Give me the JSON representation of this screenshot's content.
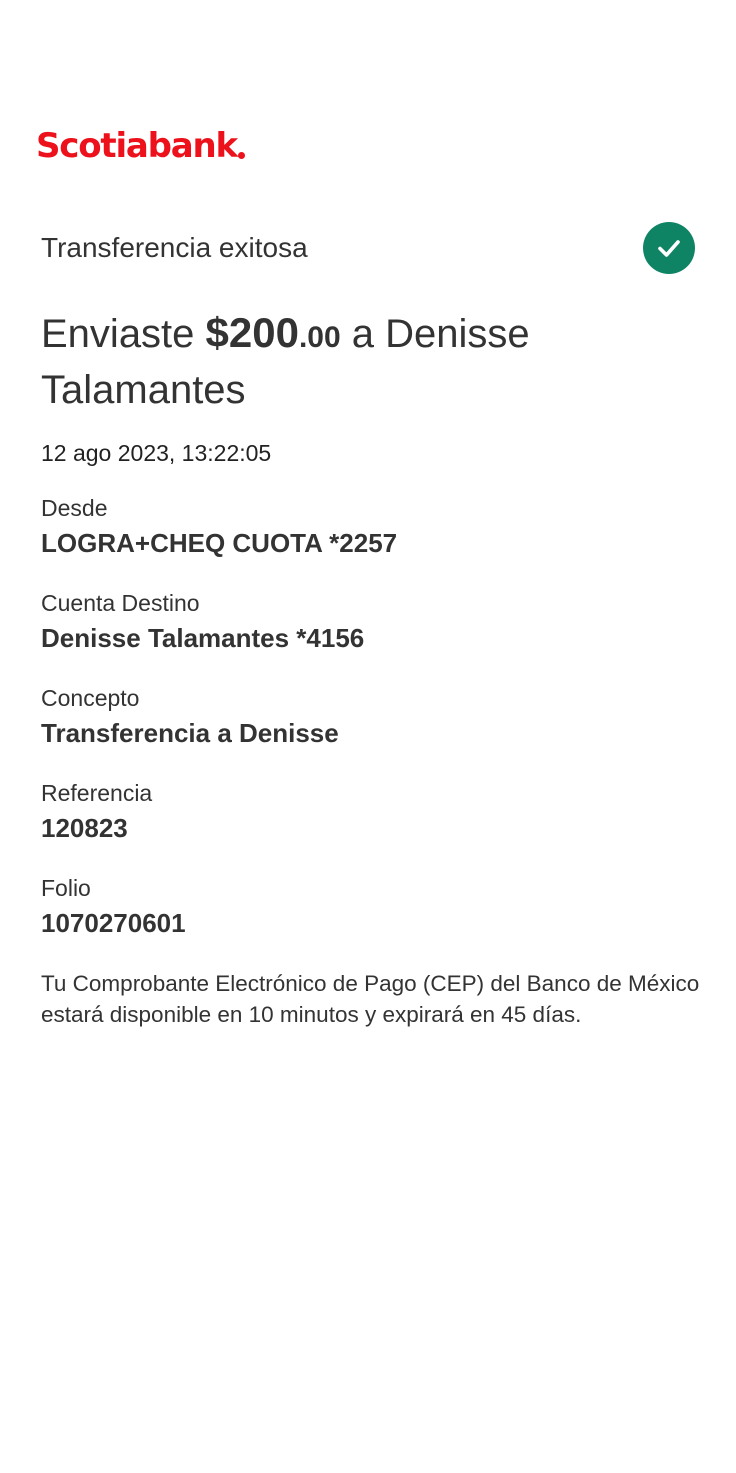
{
  "brand": {
    "name": "Scotiabank",
    "color": "#ec111a"
  },
  "status": {
    "title": "Transferencia exitosa",
    "icon": "check-circle-icon",
    "icon_color": "#0f8465"
  },
  "summary": {
    "prefix": "Enviaste ",
    "amount_main": "$200",
    "amount_cents": ".00",
    "suffix": " a Denisse Talamantes"
  },
  "datetime": "12 ago 2023, 13:22:05",
  "details": {
    "from_label": "Desde",
    "from_value": "LOGRA+CHEQ CUOTA *2257",
    "destination_label": "Cuenta Destino",
    "destination_value": "Denisse Talamantes *4156",
    "concept_label": "Concepto",
    "concept_value": "Transferencia a Denisse",
    "reference_label": "Referencia",
    "reference_value": "120823",
    "folio_label": "Folio",
    "folio_value": "1070270601"
  },
  "note": "Tu Comprobante Electrónico de Pago (CEP) del Banco de México estará disponible en 10 minutos y expirará en 45 días."
}
